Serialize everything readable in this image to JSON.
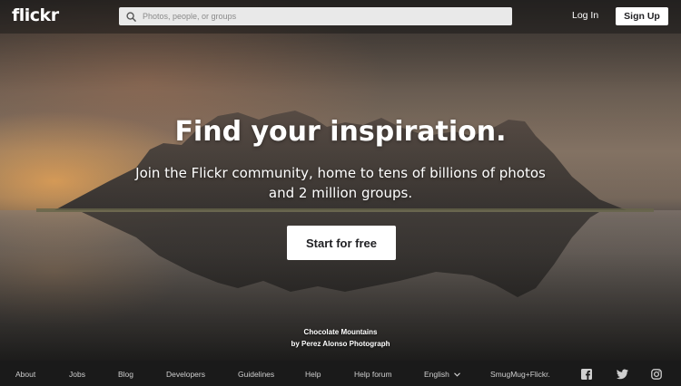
{
  "header": {
    "logo": "flickr",
    "search_placeholder": "Photos, people, or groups",
    "login_label": "Log In",
    "signup_label": "Sign Up"
  },
  "hero": {
    "headline": "Find your inspiration.",
    "subline": "Join the Flickr community, home to tens of billions of photos and 2 million groups.",
    "cta_label": "Start for free",
    "photo_title": "Chocolate Mountains",
    "photo_author": "by Perez Alonso Photograph"
  },
  "footer": {
    "links": [
      "About",
      "Jobs",
      "Blog",
      "Developers",
      "Guidelines",
      "Help",
      "Help forum",
      "English",
      "SmugMug+Flickr."
    ],
    "social_icons": [
      "facebook-icon",
      "twitter-icon",
      "instagram-icon"
    ]
  },
  "colors": {
    "button_bg": "#ffffff",
    "button_text": "#212124",
    "footer_bg": "#1a1a1a",
    "search_bg": "#e9e9e9"
  }
}
